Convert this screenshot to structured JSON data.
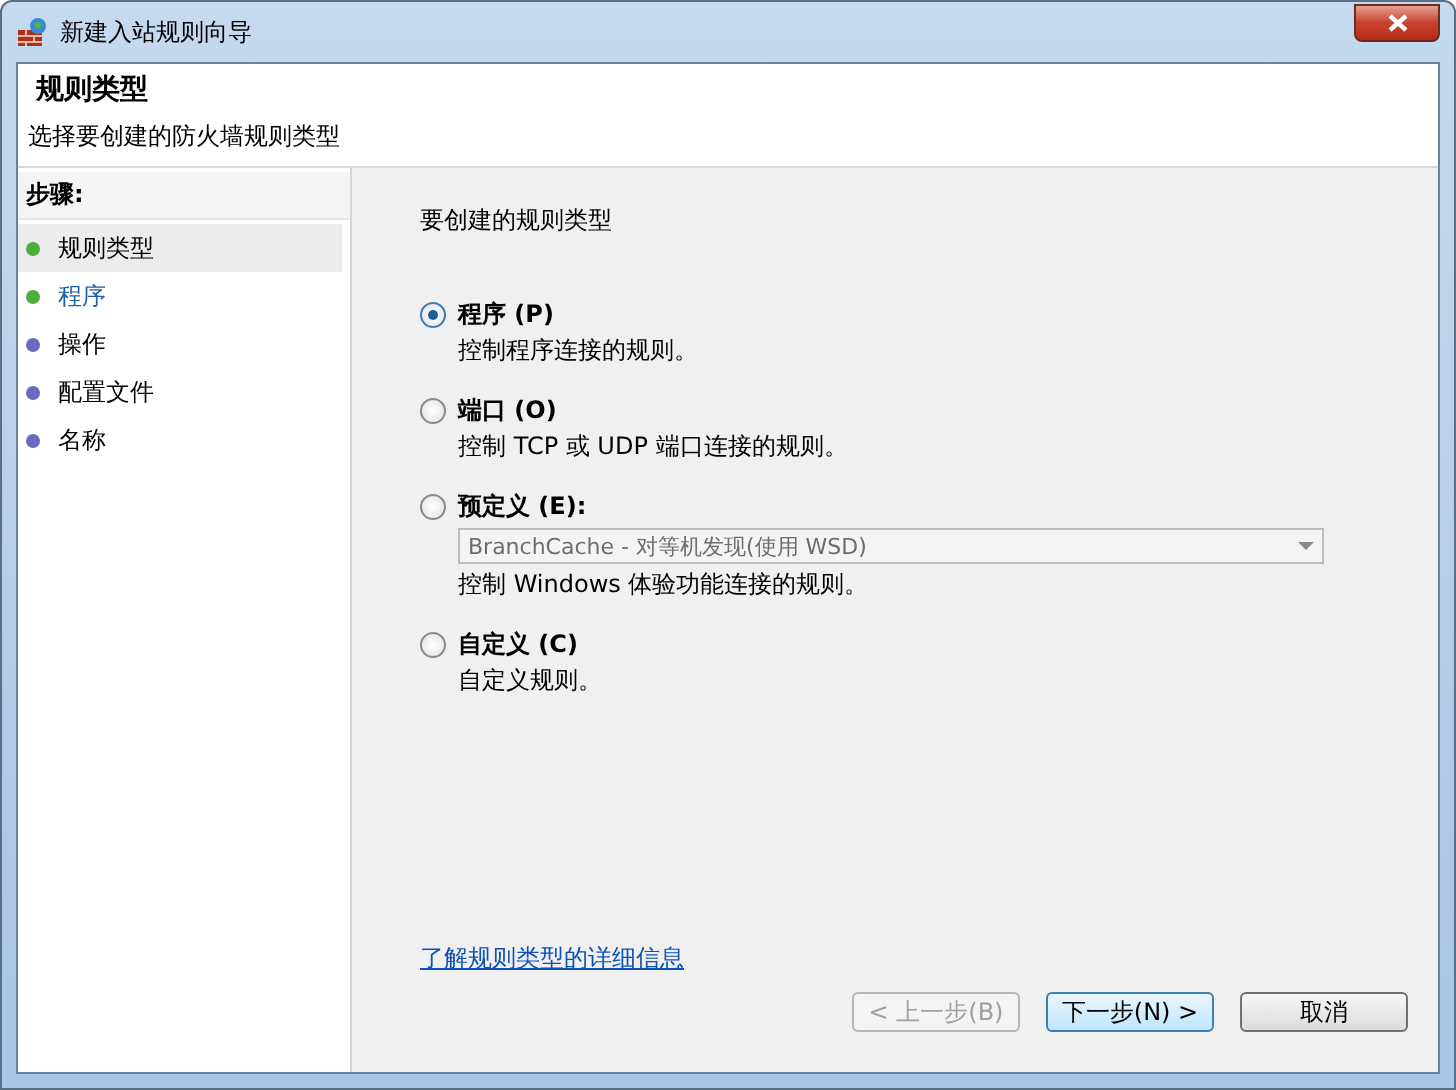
{
  "window": {
    "title": "新建入站规则向导"
  },
  "header": {
    "title": "规则类型",
    "subtitle": "选择要创建的防火墙规则类型"
  },
  "steps": {
    "heading": "步骤:",
    "items": [
      {
        "label": "规则类型",
        "selected": true,
        "active": false,
        "color": "#4caf3c"
      },
      {
        "label": "程序",
        "selected": false,
        "active": true,
        "color": "#4caf3c"
      },
      {
        "label": "操作",
        "selected": false,
        "active": false,
        "color": "#6a6ac0"
      },
      {
        "label": "配置文件",
        "selected": false,
        "active": false,
        "color": "#6a6ac0"
      },
      {
        "label": "名称",
        "selected": false,
        "active": false,
        "color": "#6a6ac0"
      }
    ]
  },
  "question": "要创建的规则类型",
  "options": [
    {
      "label": "程序 (P)",
      "description": "控制程序连接的规则。",
      "selected": true
    },
    {
      "label": "端口 (O)",
      "description": "控制 TCP 或 UDP 端口连接的规则。",
      "selected": false
    },
    {
      "label": "预定义 (E):",
      "description": "控制 Windows 体验功能连接的规则。",
      "selected": false,
      "dropdown": {
        "value": "BranchCache - 对等机发现(使用 WSD)",
        "disabled": true
      }
    },
    {
      "label": "自定义 (C)",
      "description": "自定义规则。",
      "selected": false
    }
  ],
  "link": "了解规则类型的详细信息",
  "buttons": [
    {
      "label": "< 上一步(B)",
      "disabled": true,
      "default": false
    },
    {
      "label": "下一步(N) >",
      "disabled": false,
      "default": true
    },
    {
      "label": "取消",
      "disabled": false,
      "default": false
    }
  ]
}
